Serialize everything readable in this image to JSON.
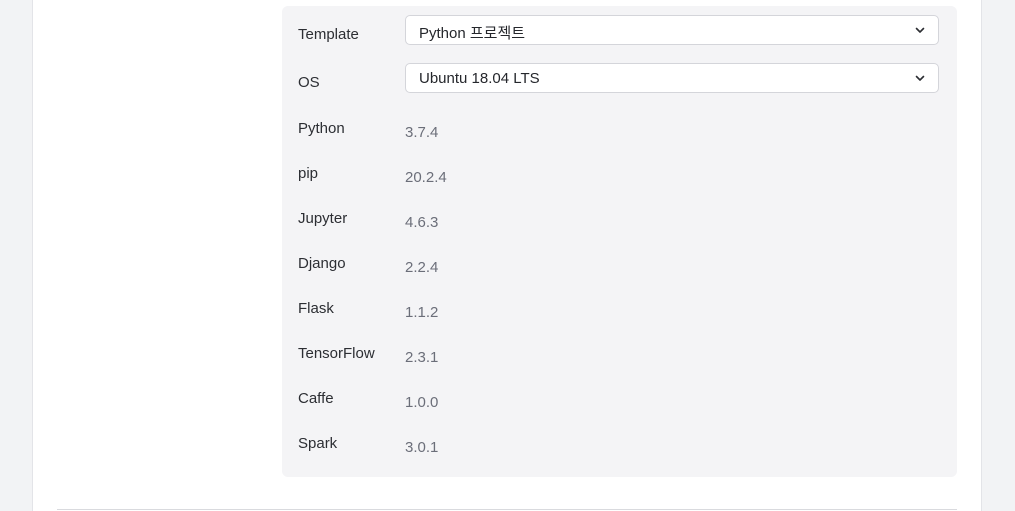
{
  "settings": {
    "template": {
      "label": "Template",
      "selected": "Python 프로젝트"
    },
    "os": {
      "label": "OS",
      "selected": "Ubuntu 18.04 LTS"
    },
    "packages": [
      {
        "label": "Python",
        "version": "3.7.4"
      },
      {
        "label": "pip",
        "version": "20.2.4"
      },
      {
        "label": "Jupyter",
        "version": "4.6.3"
      },
      {
        "label": "Django",
        "version": "2.2.4"
      },
      {
        "label": "Flask",
        "version": "1.1.2"
      },
      {
        "label": "TensorFlow",
        "version": "2.3.1"
      },
      {
        "label": "Caffe",
        "version": "1.0.0"
      },
      {
        "label": "Spark",
        "version": "3.0.1"
      }
    ]
  },
  "icons": {
    "dropdown": "chevron-down-icon"
  }
}
